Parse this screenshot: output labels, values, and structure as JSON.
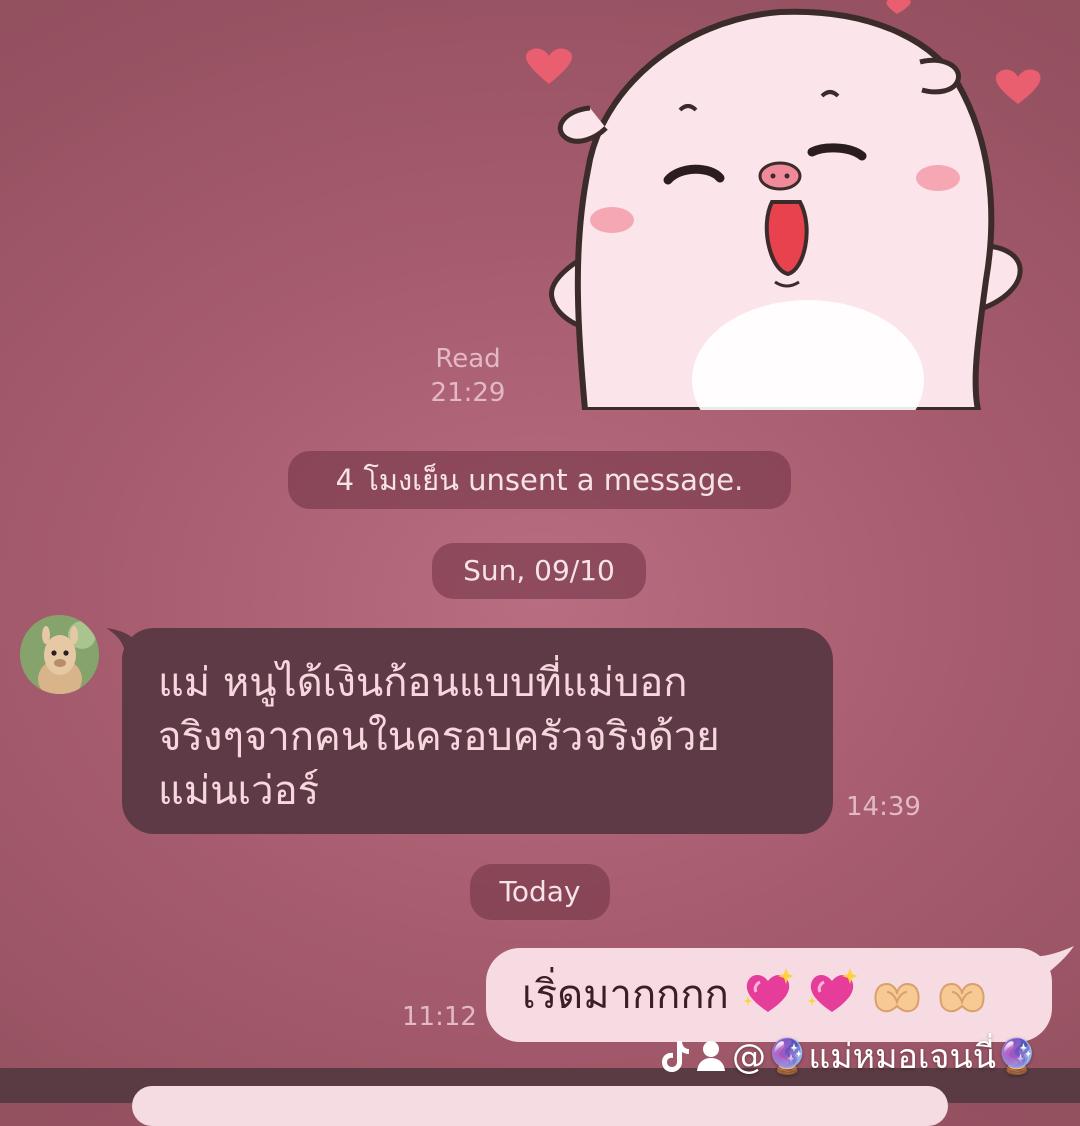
{
  "chat": {
    "read_label": "Read",
    "read_time": "21:29",
    "unsent_notice": "4 โมงเย็น unsent a message.",
    "date_sep_1": "Sun, 09/10",
    "date_sep_2": "Today",
    "incoming": {
      "text": "แม่ หนูได้เงินก้อนแบบที่แม่บอก\nจริงๆจากคนในครอบครัวจริงด้วย\nแม่นเว่อร์",
      "time": "14:39"
    },
    "outgoing": {
      "text": "เริ่ดมากกกก",
      "emoji_icons": [
        "sparkling-heart-icon",
        "sparkling-heart-icon",
        "heart-hands-icon",
        "heart-hands-icon"
      ],
      "time": "11:12"
    }
  },
  "watermark": {
    "icons": [
      "tiktok-icon",
      "person-icon"
    ],
    "handle": "@🔮แม่หมอเจนนี่🔮"
  },
  "colors": {
    "background": "#a85d70",
    "incoming_bubble": "#5e3a47",
    "outgoing_bubble": "#f6dbe2",
    "pill": "#6e3241"
  }
}
